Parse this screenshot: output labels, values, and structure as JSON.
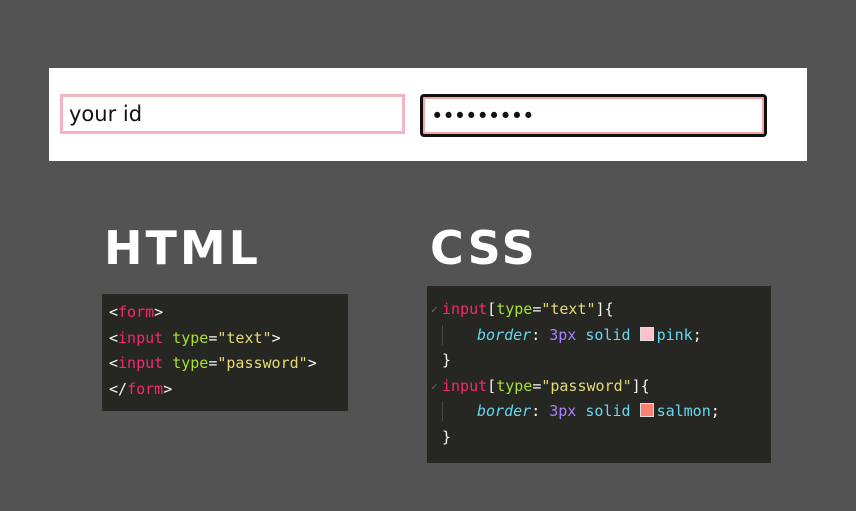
{
  "demo": {
    "text_input_value": "your id",
    "password_input_value": "•••••••••"
  },
  "headings": {
    "html": "HTML",
    "css": "CSS"
  },
  "html_code": {
    "line1": {
      "open": "<",
      "tag": "form",
      "close": ">"
    },
    "line2": {
      "open": "<",
      "tag": "input",
      "attr": "type",
      "eq": "=",
      "value": "\"text\"",
      "close": ">"
    },
    "line3": {
      "open": "<",
      "tag": "input",
      "attr": "type",
      "eq": "=",
      "value": "\"password\"",
      "close": ">"
    },
    "line4": {
      "open": "</",
      "tag": "form",
      "close": ">"
    }
  },
  "css_code": {
    "rule1": {
      "selector": "input",
      "bracket_open": "[",
      "attr": "type",
      "eq": "=",
      "value": "\"text\"",
      "bracket_close": "]{",
      "property": "border",
      "colon": ":",
      "num": "3px",
      "keyword": "solid",
      "color_name": "pink",
      "semicolon": ";",
      "swatch_color": "#ffc0cb",
      "close": "}"
    },
    "rule2": {
      "selector": "input",
      "bracket_open": "[",
      "attr": "type",
      "eq": "=",
      "value": "\"password\"",
      "bracket_close": "]{",
      "property": "border",
      "colon": ":",
      "num": "3px",
      "keyword": "solid",
      "color_name": "salmon",
      "semicolon": ";",
      "swatch_color": "#fa8072",
      "close": "}"
    }
  },
  "colors": {
    "background": "#535353",
    "code_background": "#262623",
    "tag": "#f92672",
    "attribute": "#a6e22e",
    "string": "#e6db74",
    "property": "#66d9ef",
    "number": "#ae81ff"
  }
}
